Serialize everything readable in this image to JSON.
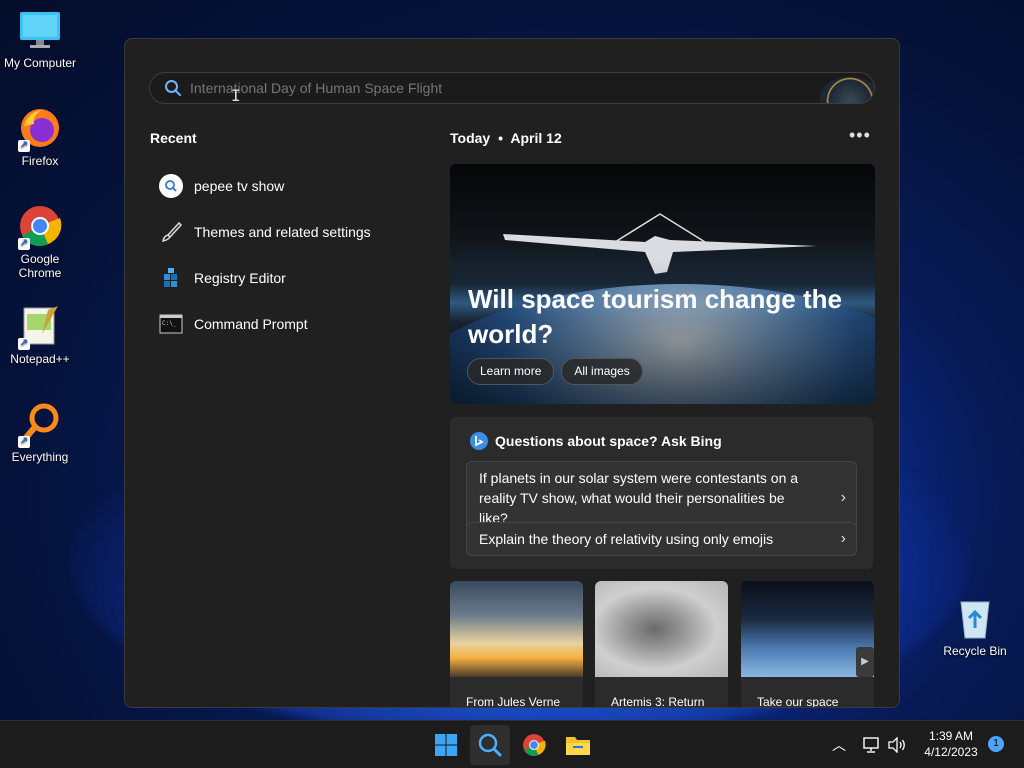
{
  "desktop": {
    "icons": [
      {
        "label": "My Computer"
      },
      {
        "label": "Firefox"
      },
      {
        "label": "Google Chrome"
      },
      {
        "label": "Notepad++"
      },
      {
        "label": "Everything"
      },
      {
        "label": "Recycle Bin"
      }
    ]
  },
  "search": {
    "placeholder": "International Day of Human Space Flight"
  },
  "recent": {
    "title": "Recent",
    "items": [
      {
        "label": "pepee tv show",
        "icon": "search-icon"
      },
      {
        "label": "Themes and related settings",
        "icon": "brush-icon"
      },
      {
        "label": "Registry Editor",
        "icon": "registry-icon"
      },
      {
        "label": "Command Prompt",
        "icon": "terminal-icon"
      }
    ]
  },
  "today": {
    "label": "Today",
    "separator": "•",
    "date": "April 12",
    "more_label": "•••"
  },
  "hero": {
    "title": "Will space tourism change the world?",
    "learn_more": "Learn more",
    "all_images": "All images"
  },
  "ask_bing": {
    "title": "Questions about space? Ask Bing",
    "questions": [
      "If planets in our solar system were contestants on a reality TV show, what would their personalities be like?",
      "Explain the theory of relativity using only emojis"
    ]
  },
  "cards": [
    {
      "caption": "From Jules Verne"
    },
    {
      "caption": "Artemis 3: Return"
    },
    {
      "caption": "Take our space"
    }
  ],
  "taskbar": {
    "time": "1:39 AM",
    "date": "4/12/2023",
    "notification_count": "1"
  },
  "colors": {
    "panel_bg": "#202020",
    "accent": "#4aa3ff",
    "taskbar_bg": "#1c1c1c"
  }
}
